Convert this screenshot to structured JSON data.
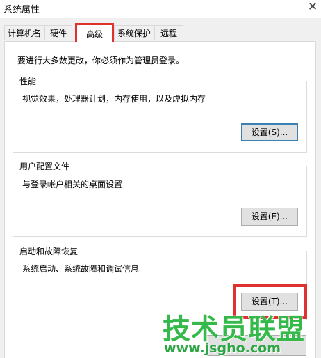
{
  "window": {
    "title": "系统属性",
    "close_glyph": "✕"
  },
  "tabs": [
    {
      "label": "计算机名",
      "active": false
    },
    {
      "label": "硬件",
      "active": false
    },
    {
      "label": "高级",
      "active": true
    },
    {
      "label": "系统保护",
      "active": false
    },
    {
      "label": "远程",
      "active": false
    }
  ],
  "admin_note": "要进行大多数更改，你必须作为管理员登录。",
  "groups": {
    "performance": {
      "title": "性能",
      "description": "视觉效果，处理器计划，内存使用，以及虚拟内存",
      "button": "设置(S)..."
    },
    "user_profiles": {
      "title": "用户配置文件",
      "description": "与登录帐户相关的桌面设置",
      "button": "设置(E)..."
    },
    "startup_recovery": {
      "title": "启动和故障恢复",
      "description": "系统启动、系统故障和调试信息",
      "button": "设置(T)..."
    }
  },
  "watermark": {
    "brand": "技术员联盟",
    "url": "www.jsgho.com"
  },
  "colors": {
    "highlight": "#e03131",
    "watermark": "#35b94a",
    "focus": "#3c7fb1"
  }
}
